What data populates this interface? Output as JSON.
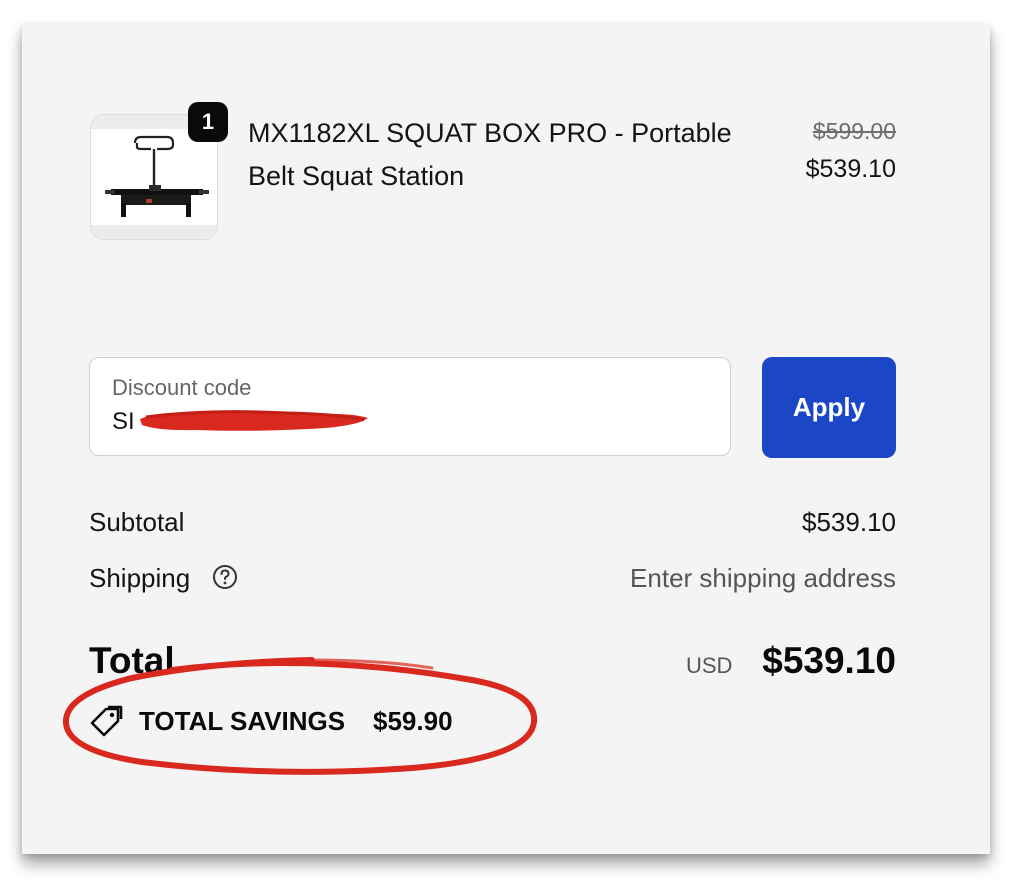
{
  "line_item": {
    "quantity_badge": "1",
    "name": "MX1182XL SQUAT BOX PRO - Portable Belt Squat Station",
    "original_price": "$599.00",
    "sale_price": "$539.10",
    "thumbnail_icon": "belt-squat-station-image"
  },
  "discount": {
    "label": "Discount code",
    "value": "SI",
    "apply_label": "Apply",
    "redaction_color": "#d9281e"
  },
  "summary": {
    "subtotal_label": "Subtotal",
    "subtotal_value": "$539.10",
    "shipping_label": "Shipping",
    "shipping_value": "Enter shipping address",
    "help_icon": "question-circle-icon",
    "total_label": "Total",
    "total_currency": "USD",
    "total_value": "$539.10",
    "savings_label": "TOTAL SAVINGS",
    "savings_value": "$59.90",
    "savings_icon": "price-tag-icon"
  },
  "colors": {
    "accent": "#1b46c6",
    "annotation": "#d9281e",
    "background": "#f4f4f4"
  }
}
